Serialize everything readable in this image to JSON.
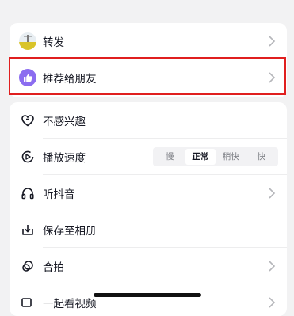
{
  "menu_primary": [
    {
      "label": "转发",
      "icon": "avatar-thumbnail"
    },
    {
      "label": "推荐给朋友",
      "icon": "thumbs-up-icon"
    }
  ],
  "menu_secondary": {
    "not_interested": {
      "label": "不感兴趣",
      "icon": "heart-outline-icon"
    },
    "playback_speed": {
      "label": "播放速度",
      "icon": "play-speed-icon",
      "options": [
        "慢",
        "正常",
        "稍快",
        "快"
      ],
      "selected": "正常"
    },
    "listen": {
      "label": "听抖音",
      "icon": "headphones-icon"
    },
    "save_to_album": {
      "label": "保存至相册",
      "icon": "download-icon"
    },
    "duet": {
      "label": "合拍",
      "icon": "duet-icon"
    },
    "partial": {
      "label": "一起看视频"
    }
  },
  "colors": {
    "background": "#F2F2F3",
    "card": "#FFFFFF",
    "highlight_border": "#E01F1F",
    "thumb_badge": "#8B6CF0"
  }
}
